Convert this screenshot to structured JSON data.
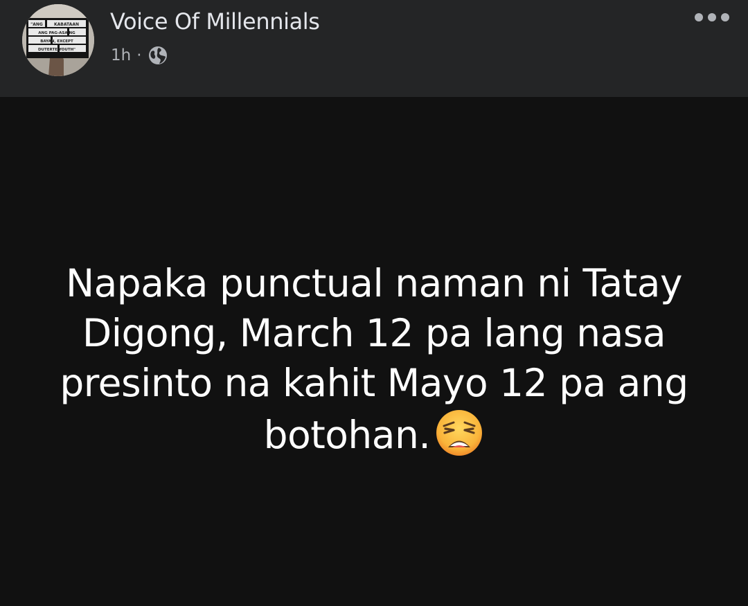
{
  "post": {
    "author": "Voice Of Millennials",
    "time": "1h",
    "separator": "·",
    "privacy_icon": "globe-icon",
    "more_icon": "more-options-icon",
    "text": "Napaka punctual naman ni Tatay Digong, March 12 pa lang nasa presinto na kahit Mayo 12 pa ang botohan.",
    "emoji": "weary-face-icon"
  },
  "avatar": {
    "sign_lines": [
      "\"ANG",
      "KABATAAN",
      "ANG PAG-ASA NG",
      "BAYAN, EXCEPT",
      "DUTERTE YOUTH\""
    ]
  },
  "colors": {
    "header_bg": "#242526",
    "post_bg": "#111111",
    "text_primary": "#e4e6eb",
    "text_secondary": "#b0b3b8",
    "post_text": "#ffffff"
  }
}
